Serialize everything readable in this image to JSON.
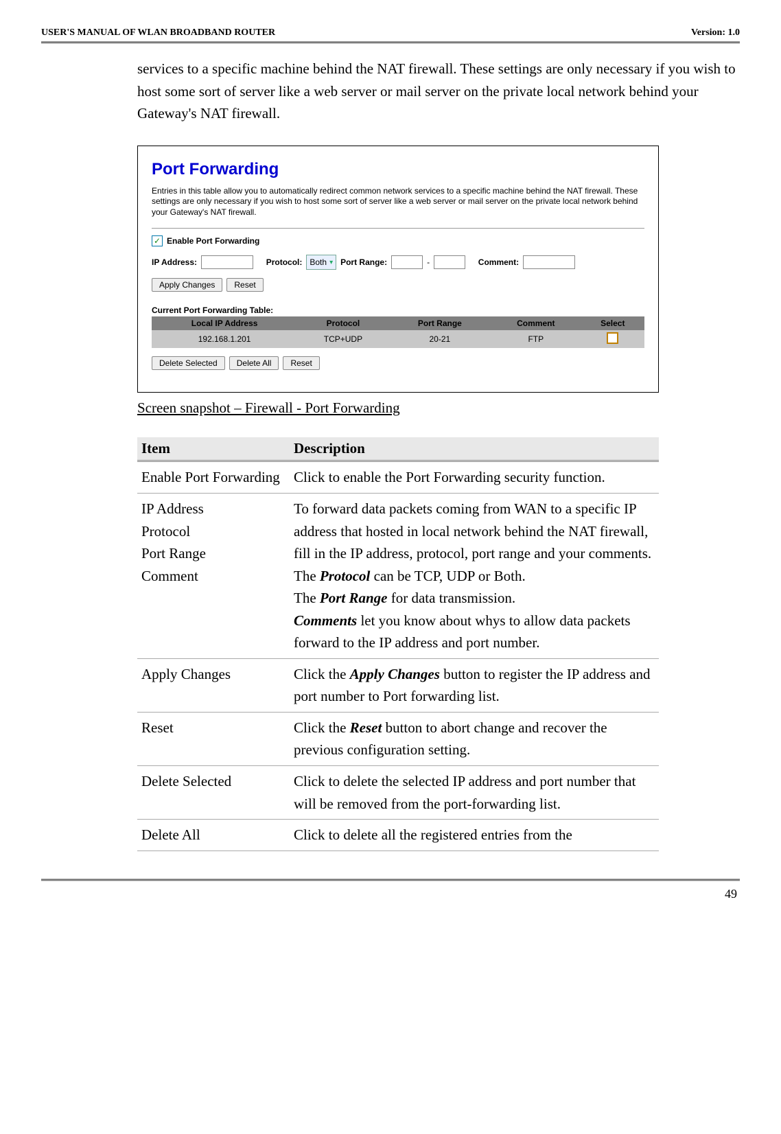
{
  "header": {
    "left": "USER'S MANUAL OF WLAN BROADBAND ROUTER",
    "right": "Version: 1.0"
  },
  "intro_text": "services to a specific machine behind the NAT firewall. These settings are only necessary if you wish to host some sort of server like a web server or mail server on the private local network behind your Gateway's NAT firewall.",
  "panel": {
    "title": "Port Forwarding",
    "desc": "Entries in this table allow you to automatically redirect common network services to a specific machine behind the NAT firewall. These settings are only necessary if you wish to host some sort of server like a web server or mail server on the private local network behind your Gateway's NAT firewall.",
    "enable_label": "Enable Port Forwarding",
    "ip_label": "IP Address:",
    "protocol_label": "Protocol:",
    "protocol_value": "Both",
    "portrange_label": "Port Range:",
    "portrange_sep": "-",
    "comment_label": "Comment:",
    "apply_btn": "Apply Changes",
    "reset_btn": "Reset",
    "table_title": "Current Port Forwarding Table:",
    "cols": {
      "c1": "Local IP Address",
      "c2": "Protocol",
      "c3": "Port Range",
      "c4": "Comment",
      "c5": "Select"
    },
    "row": {
      "ip": "192.168.1.201",
      "proto": "TCP+UDP",
      "range": "20-21",
      "comment": "FTP"
    },
    "del_sel": "Delete Selected",
    "del_all": "Delete All",
    "reset2": "Reset"
  },
  "caption": "Screen snapshot – Firewall - Port Forwarding",
  "table": {
    "h1": "Item",
    "h2": "Description",
    "rows": [
      {
        "item": "Enable Port Forwarding",
        "desc": "Click to enable the Port Forwarding security function."
      }
    ],
    "ip_block": {
      "items": [
        "IP Address",
        "Protocol",
        "Port Range",
        "Comment"
      ],
      "l1": "To forward data packets coming from WAN to a specific IP address that hosted in local network behind the NAT firewall, fill in the IP address, protocol, port range and your comments.",
      "l2a": "The ",
      "l2b": "Protocol",
      "l2c": " can be TCP, UDP or Both.",
      "l3a": "The ",
      "l3b": "Port Range",
      "l3c": " for data transmission.",
      "l4a": "Comments",
      "l4b": " let you know about whys to allow data packets forward to the IP address and port number."
    },
    "apply": {
      "item": "Apply Changes",
      "d1": "Click the ",
      "d2": "Apply Changes",
      "d3": " button to register the IP address and port number to Port forwarding list."
    },
    "reset": {
      "item": "Reset",
      "d1": "Click the ",
      "d2": "Reset",
      "d3": " button to abort change and recover the previous configuration setting."
    },
    "delsel": {
      "item": "Delete Selected",
      "desc": "Click to delete the selected IP address and port number that will be removed from the port-forwarding list."
    },
    "delall": {
      "item": "Delete All",
      "desc": "Click to delete all the registered entries from the"
    }
  },
  "page_num": "49"
}
